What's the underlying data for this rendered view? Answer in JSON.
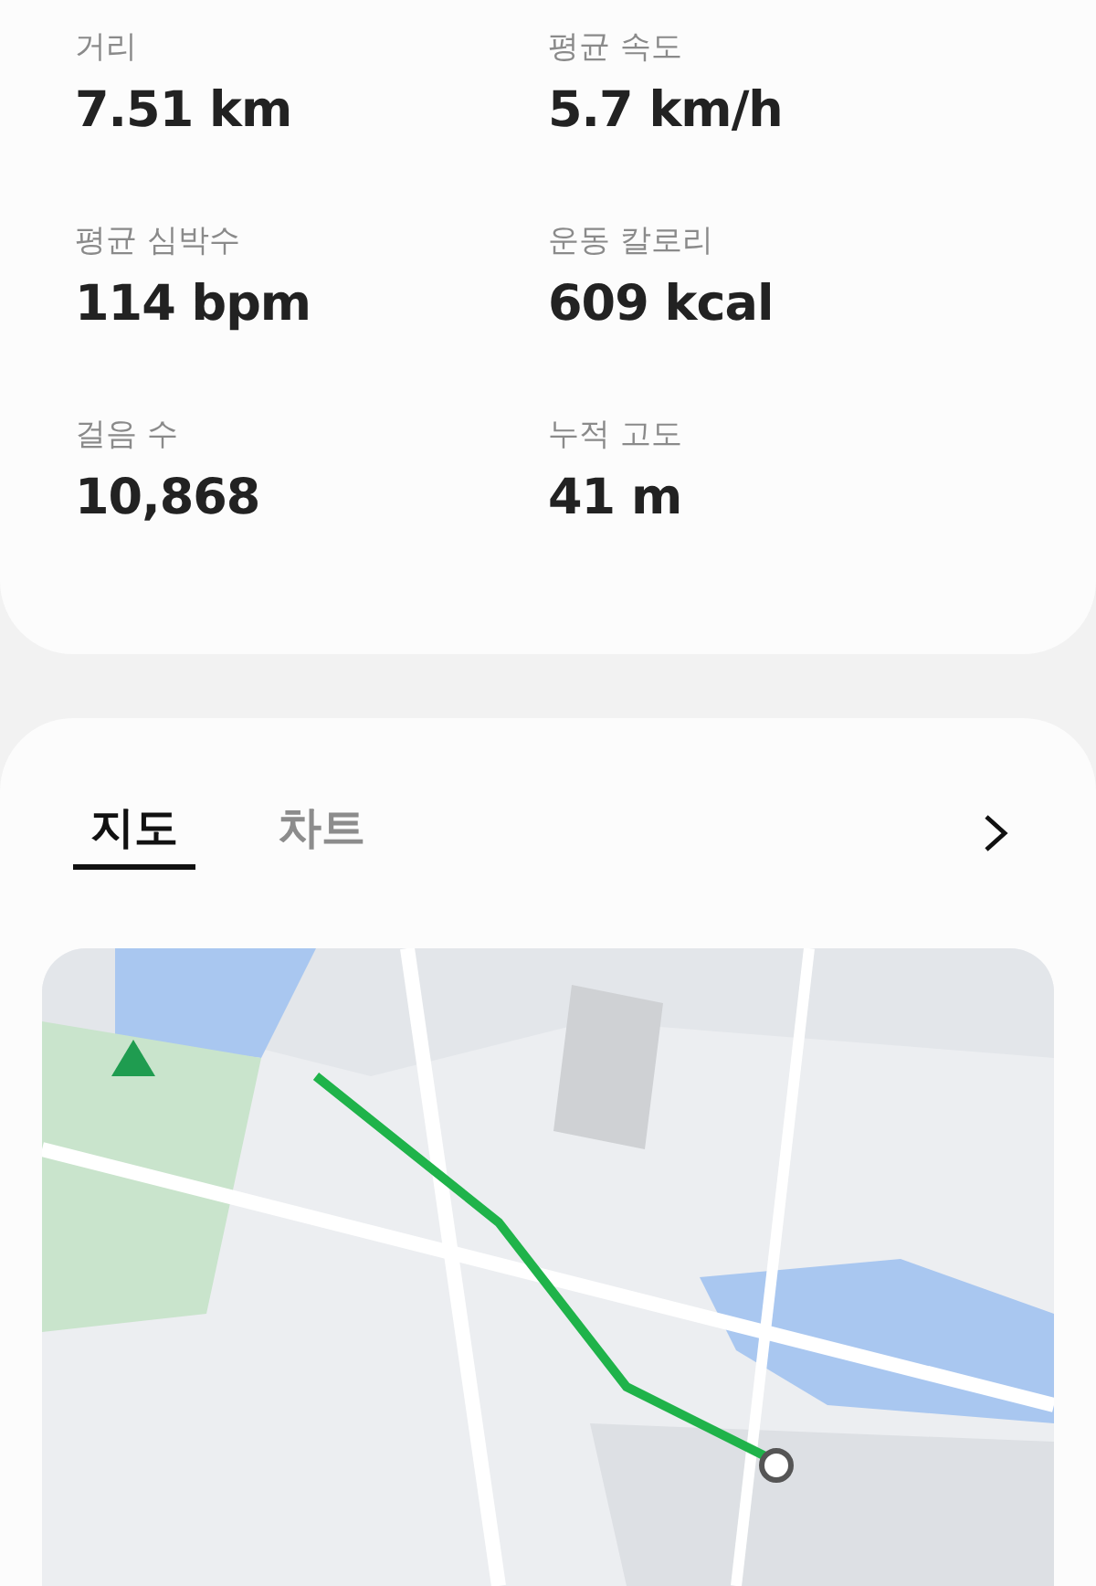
{
  "stats": [
    {
      "label": "거리",
      "value": "7.51 km"
    },
    {
      "label": "평균 속도",
      "value": "5.7 km/h"
    },
    {
      "label": "평균 심박수",
      "value": "114 bpm"
    },
    {
      "label": "운동 칼로리",
      "value": "609 kcal"
    },
    {
      "label": "걸음 수",
      "value": "10,868"
    },
    {
      "label": "누적 고도",
      "value": "41 m"
    }
  ],
  "tabs": [
    {
      "label": "지도",
      "selected": true
    },
    {
      "label": "차트",
      "selected": false
    }
  ]
}
